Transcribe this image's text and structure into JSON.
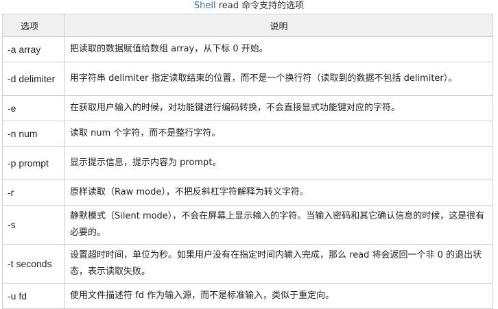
{
  "caption": {
    "keyword": "Shell",
    "rest": " read 命令支持的选项"
  },
  "table": {
    "headers": [
      "选项",
      "说明"
    ],
    "rows": [
      {
        "option": "-a array",
        "description": "把读取的数据赋值给数组 array，从下标 0 开始。"
      },
      {
        "option": "-d delimiter",
        "description": "用字符串 delimiter 指定读取结束的位置，而不是一个换行符（读取到的数据不包括 delimiter）。"
      },
      {
        "option": "-e",
        "description": "在获取用户输入的时候，对功能键进行编码转换，不会直接显式功能键对应的字符。"
      },
      {
        "option": "-n num",
        "description": "读取 num 个字符，而不是整行字符。"
      },
      {
        "option": "-p prompt",
        "description": "显示提示信息，提示内容为 prompt。"
      },
      {
        "option": "-r",
        "description": "原样读取（Raw mode），不把反斜杠字符解释为转义字符。"
      },
      {
        "option": "-s",
        "description": "静默模式（Silent mode），不会在屏幕上显示输入的字符。当输入密码和其它确认信息的时候，这是很有必要的。"
      },
      {
        "option": "-t seconds",
        "description": "设置超时时间，单位为秒。如果用户没有在指定时间内输入完成，那么 read 将会返回一个非 0 的退出状态，表示读取失败。"
      },
      {
        "option": "-u fd",
        "description": "使用文件描述符 fd 作为输入源，而不是标准输入，类似于重定向。"
      }
    ]
  }
}
